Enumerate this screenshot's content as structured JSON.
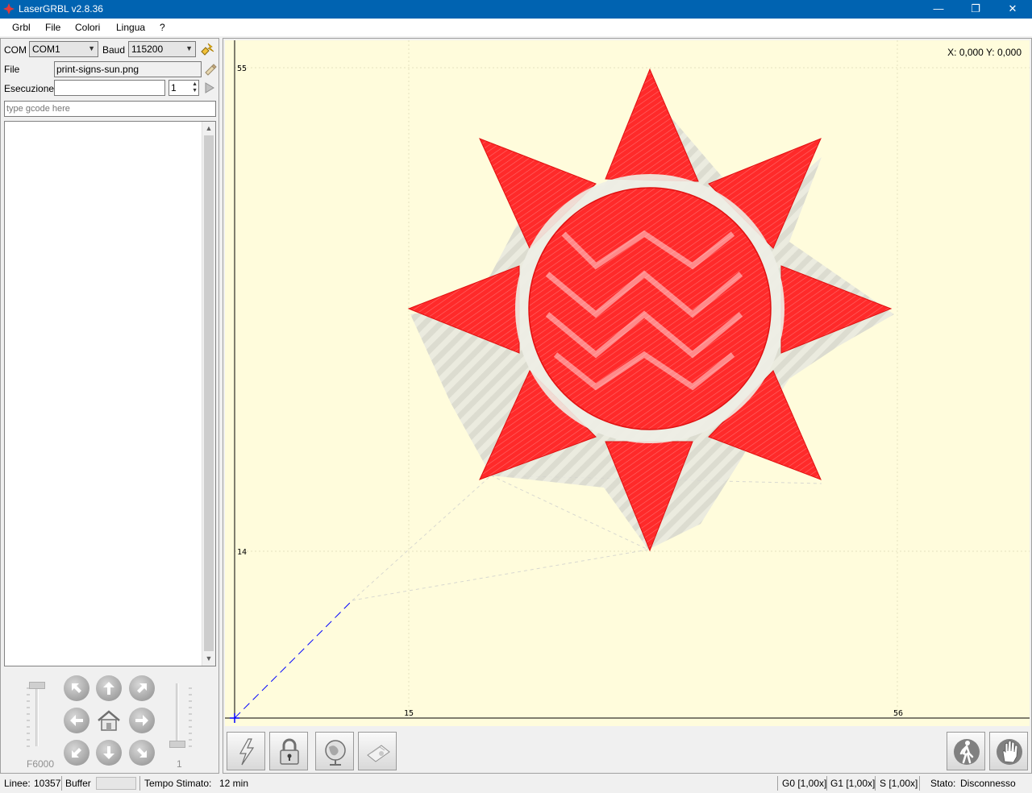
{
  "window": {
    "title": "LaserGRBL v2.8.36",
    "minimize": "—",
    "restore": "❐",
    "close": "✕"
  },
  "menu": {
    "items": [
      "Grbl",
      "File",
      "Colori",
      "Lingua",
      "?"
    ]
  },
  "connection": {
    "com_label": "COM",
    "com_value": "COM1",
    "baud_label": "Baud",
    "baud_value": "115200"
  },
  "file": {
    "label": "File",
    "value": "print-signs-sun.png"
  },
  "run": {
    "label": "Esecuzione",
    "value": "",
    "count": "1"
  },
  "gcode": {
    "placeholder": "type gcode here"
  },
  "jog": {
    "feed_label": "F6000",
    "step_label": "1",
    "icons": [
      "up-left-arrow-icon",
      "up-arrow-icon",
      "up-right-arrow-icon",
      "left-arrow-icon",
      "home-icon",
      "right-arrow-icon",
      "down-left-arrow-icon",
      "down-arrow-icon",
      "down-right-arrow-icon"
    ]
  },
  "canvas": {
    "position_readout": "X: 0,000 Y: 0,000",
    "y_axis_labels": [
      "55",
      "14"
    ],
    "x_axis_labels": [
      "15",
      "56"
    ],
    "colors": {
      "background": "#fffcdc",
      "engrave": "#ff2020",
      "axis": "#000000",
      "origin": "#0000ff"
    }
  },
  "toolbar": {
    "icons": [
      "laser-power-icon",
      "unlock-icon",
      "globe-icon",
      "engrave-mode-icon",
      "walk-icon",
      "stop-hand-icon"
    ]
  },
  "status": {
    "lines_label": "Linee:",
    "lines_value": "10357",
    "buffer_label": "Buffer",
    "time_label": "Tempo Stimato:",
    "time_value": "12 min",
    "g0": "G0 [1,00x]",
    "g1": "G1 [1,00x]",
    "s": "S [1,00x]",
    "state_label": "Stato:",
    "state_value": "Disconnesso"
  }
}
